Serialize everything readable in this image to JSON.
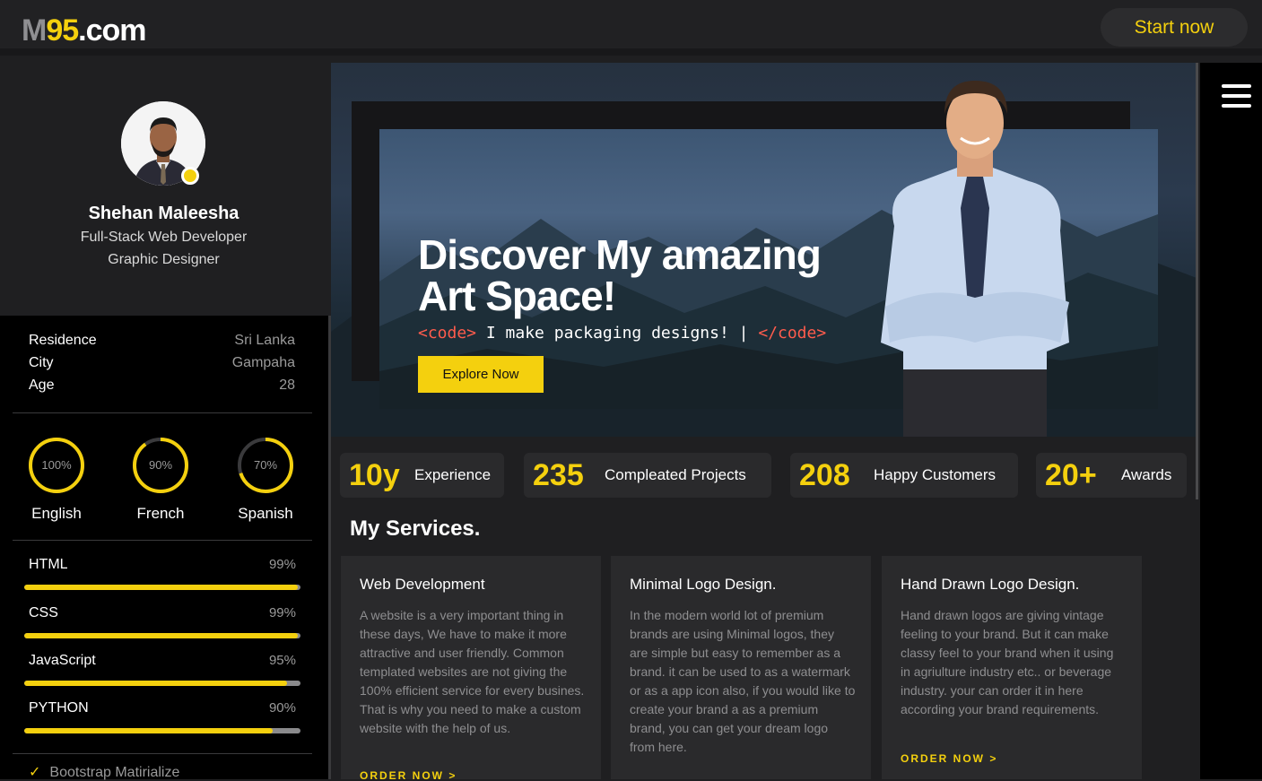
{
  "header": {
    "logo_m": "M",
    "logo_num": "95",
    "logo_dom": ".com",
    "start_label": "Start now"
  },
  "profile": {
    "name": "Shehan Maleesha",
    "roles": [
      "Full-Stack Web Developer",
      "Graphic Designer"
    ]
  },
  "info": [
    {
      "key": "Residence",
      "value": "Sri Lanka"
    },
    {
      "key": "City",
      "value": "Gampaha"
    },
    {
      "key": "Age",
      "value": "28"
    }
  ],
  "languages": [
    {
      "name": "English",
      "percent_label": "100%",
      "level": 100
    },
    {
      "name": "French",
      "percent_label": "90%",
      "level": 90
    },
    {
      "name": "Spanish",
      "percent_label": "70%",
      "level": 70
    }
  ],
  "skills": [
    {
      "name": "HTML",
      "percent_label": "99%",
      "level": 99
    },
    {
      "name": "CSS",
      "percent_label": "99%",
      "level": 99
    },
    {
      "name": "JavaScript",
      "percent_label": "95%",
      "level": 95
    },
    {
      "name": "PYTHON",
      "percent_label": "90%",
      "level": 90
    }
  ],
  "extras": [
    {
      "check": "✓",
      "label": "Bootstrap Matirialize"
    }
  ],
  "hero": {
    "title": "Discover My amazing Art Space!",
    "code_open": "<code>",
    "code_text": " I make packaging designs!",
    "code_close": "</code>",
    "button_label": "Explore Now"
  },
  "stats": [
    {
      "number": "10y",
      "label": "Experience"
    },
    {
      "number": "235",
      "label": "Compleated Projects"
    },
    {
      "number": "208",
      "label": "Happy Customers"
    },
    {
      "number": "20+",
      "label": "Awards"
    }
  ],
  "services": {
    "heading": "My Services.",
    "items": [
      {
        "title": "Web Development",
        "description": "A website is a very important thing in these days, We have to make it more attractive and user friendly. Common templated websites are not giving the 100% efficient service for every busines. That is why you need to make a custom website with the help of us.",
        "order_label": "ORDER NOW >"
      },
      {
        "title": "Minimal Logo Design.",
        "description": "In the modern world lot of premium brands are using Minimal logos, they are simple but easy to remember as a brand. it can be used to as a watermark or as a app icon also, if you would like to create your brand a as a premium brand, you can get your dream logo from here.",
        "order_label": "ORDER NOW >"
      },
      {
        "title": "Hand Drawn Logo Design.",
        "description": "Hand drawn logos are giving vintage feeling to your brand. But it can make classy feel to your brand when it using in agriulture industry etc.. or beverage industry. your can order it in here according your brand requirements.",
        "order_label": "ORDER NOW >"
      }
    ]
  },
  "colors": {
    "accent": "#f4d00e",
    "background": "#1f1f21",
    "sidebar": "#000000",
    "card": "#2a2a2c",
    "code_tag": "#ff5c4d"
  },
  "icons": {
    "menu": "hamburger-icon",
    "check": "check-icon",
    "status": "online-status-dot"
  }
}
